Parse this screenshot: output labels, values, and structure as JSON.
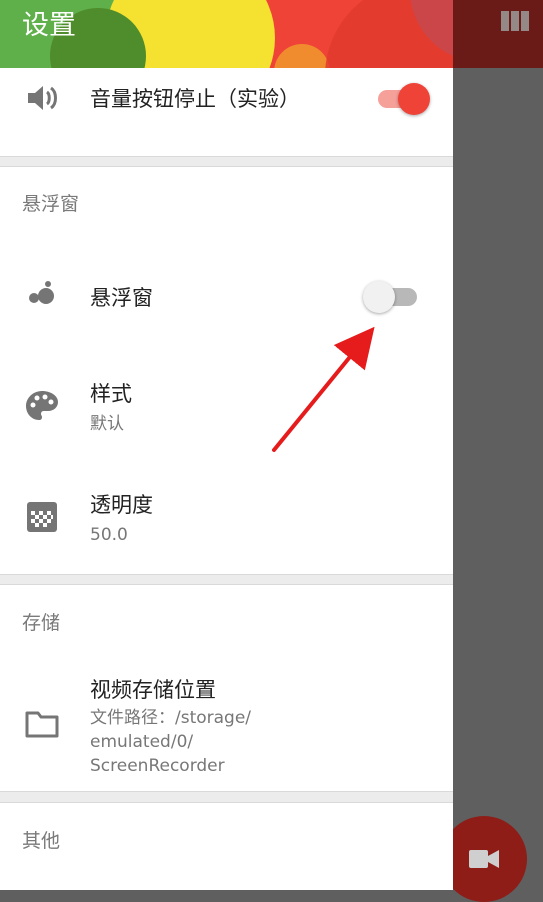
{
  "colors": {
    "accent": "#ef4338",
    "arrow": "#e61b1b",
    "backdrop": "#5f5f5f",
    "fab": "#8e1d18"
  },
  "header": {
    "title": "设置"
  },
  "rows": {
    "volume": {
      "title": "音量按钮停止（实验）",
      "icon": "volume-icon",
      "toggle_on": true
    },
    "overlay_section": "悬浮窗",
    "overlay": {
      "title": "悬浮窗",
      "icon": "bubbles-icon",
      "toggle_on": false
    },
    "style": {
      "title": "样式",
      "subtitle": "默认",
      "icon": "palette-icon"
    },
    "opacity": {
      "title": "透明度",
      "subtitle": "50.0",
      "icon": "opacity-icon"
    },
    "storage_section": "存储",
    "storage": {
      "title": "视频存储位置",
      "subtitle": "文件路径：/storage/\nemulated/0/\nScreenRecorder",
      "icon": "folder-icon"
    },
    "other_section": "其他"
  },
  "overlay_controls": {
    "grid_icon": "grid-icon",
    "fab_icon": "video-camera-icon"
  }
}
